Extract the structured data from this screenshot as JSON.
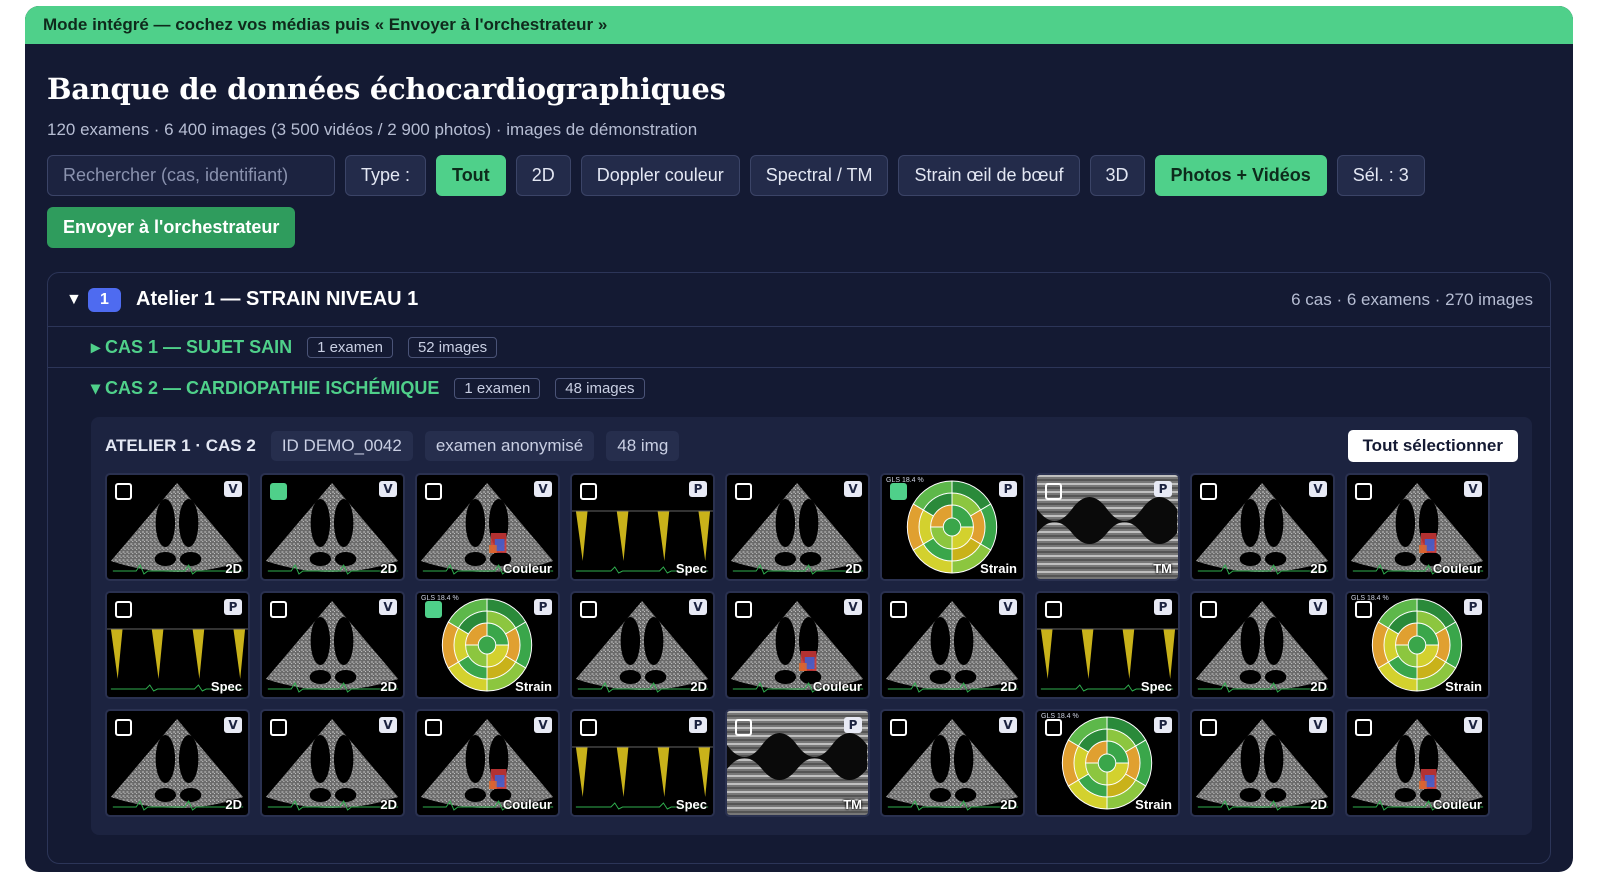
{
  "banner": "Mode intégré — cochez vos médias puis « Envoyer à l'orchestrateur »",
  "title": "Banque de données échocardiographiques",
  "subtitle": "120 examens · 6 400 images (3 500 vidéos / 2 900 photos) · images de démonstration",
  "search": {
    "placeholder": "Rechercher (cas, identifiant)"
  },
  "type_label": "Type :",
  "filters": [
    {
      "label": "Tout",
      "active": true
    },
    {
      "label": "2D",
      "active": false
    },
    {
      "label": "Doppler couleur",
      "active": false
    },
    {
      "label": "Spectral / TM",
      "active": false
    },
    {
      "label": "Strain œil de bœuf",
      "active": false
    },
    {
      "label": "3D",
      "active": false
    },
    {
      "label": "Photos + Vidéos",
      "active": true
    }
  ],
  "selection_count": "Sél. : 3",
  "send_label": "Envoyer à l'orchestrateur",
  "atelier": {
    "number": "1",
    "title": "Atelier 1 — STRAIN NIVEAU 1",
    "meta": "6 cas · 6 examens · 270 images",
    "cases": [
      {
        "title": "▸ CAS 1 — SUJET SAIN",
        "exams": "1 examen",
        "images": "52 images",
        "open": false
      },
      {
        "title": "▾ CAS 2 — CARDIOPATHIE ISCHÉMIQUE",
        "exams": "1 examen",
        "images": "48 images",
        "open": true
      }
    ]
  },
  "panel": {
    "label": "ATELIER 1 · CAS 2",
    "id": "ID DEMO_0042",
    "anon": "examen anonymisé",
    "count": "48 img",
    "select_all": "Tout sélectionner"
  },
  "gls_label": "GLS 18.4 %",
  "thumbnails": [
    {
      "mode": "2D",
      "kind": "V",
      "checked": false
    },
    {
      "mode": "2D",
      "kind": "V",
      "checked": true
    },
    {
      "mode": "Couleur",
      "kind": "V",
      "checked": false
    },
    {
      "mode": "Spec",
      "kind": "P",
      "checked": false
    },
    {
      "mode": "2D",
      "kind": "V",
      "checked": false
    },
    {
      "mode": "Strain",
      "kind": "P",
      "checked": true
    },
    {
      "mode": "TM",
      "kind": "P",
      "checked": false
    },
    {
      "mode": "2D",
      "kind": "V",
      "checked": false
    },
    {
      "mode": "Couleur",
      "kind": "V",
      "checked": false
    },
    {
      "mode": "Spec",
      "kind": "P",
      "checked": false
    },
    {
      "mode": "2D",
      "kind": "V",
      "checked": false
    },
    {
      "mode": "Strain",
      "kind": "P",
      "checked": true
    },
    {
      "mode": "2D",
      "kind": "V",
      "checked": false
    },
    {
      "mode": "Couleur",
      "kind": "V",
      "checked": false
    },
    {
      "mode": "2D",
      "kind": "V",
      "checked": false
    },
    {
      "mode": "Spec",
      "kind": "P",
      "checked": false
    },
    {
      "mode": "2D",
      "kind": "V",
      "checked": false
    },
    {
      "mode": "Strain",
      "kind": "P",
      "checked": false
    },
    {
      "mode": "2D",
      "kind": "V",
      "checked": false
    },
    {
      "mode": "2D",
      "kind": "V",
      "checked": false
    },
    {
      "mode": "Couleur",
      "kind": "V",
      "checked": false
    },
    {
      "mode": "Spec",
      "kind": "P",
      "checked": false
    },
    {
      "mode": "TM",
      "kind": "P",
      "checked": false
    },
    {
      "mode": "2D",
      "kind": "V",
      "checked": false
    },
    {
      "mode": "Strain",
      "kind": "P",
      "checked": false
    },
    {
      "mode": "2D",
      "kind": "V",
      "checked": false
    },
    {
      "mode": "Couleur",
      "kind": "V",
      "checked": false
    }
  ],
  "colors": {
    "banner": "#4fd08a",
    "background": "#141a33",
    "accent_green": "#4fd08a",
    "send_button": "#2f9c5d",
    "badge_blue": "#4e6bf0"
  }
}
